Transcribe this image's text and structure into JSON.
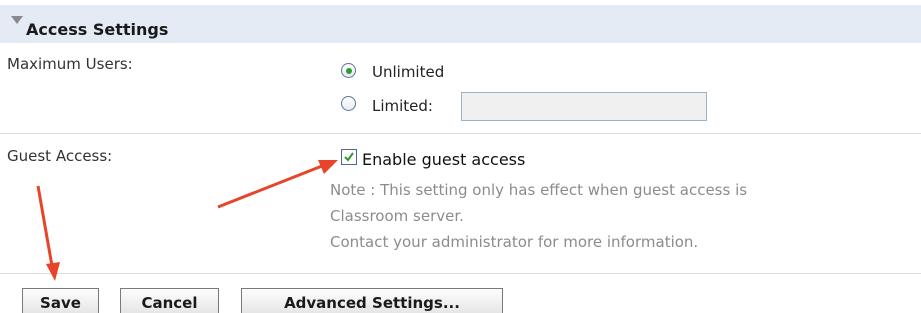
{
  "section": {
    "title": "Access Settings",
    "collapse_icon": "triangle-down-icon"
  },
  "max_users": {
    "label": "Maximum Users:",
    "options": [
      {
        "label": "Unlimited",
        "selected": true
      },
      {
        "label": "Limited:",
        "selected": false
      }
    ],
    "limited_value": ""
  },
  "guest_access": {
    "label": "Guest Access:",
    "checkbox_label": "Enable guest access",
    "checked": true,
    "note_lines": [
      "Note : This setting only has effect when guest access is",
      "Classroom server.",
      "Contact your administrator for more information."
    ]
  },
  "buttons": {
    "save": "Save",
    "cancel": "Cancel",
    "advanced": "Advanced Settings..."
  },
  "colors": {
    "header_bg": "#e4ebf4",
    "annotation_arrow": "#e8442a",
    "radio_dot": "#2f9a2f"
  }
}
